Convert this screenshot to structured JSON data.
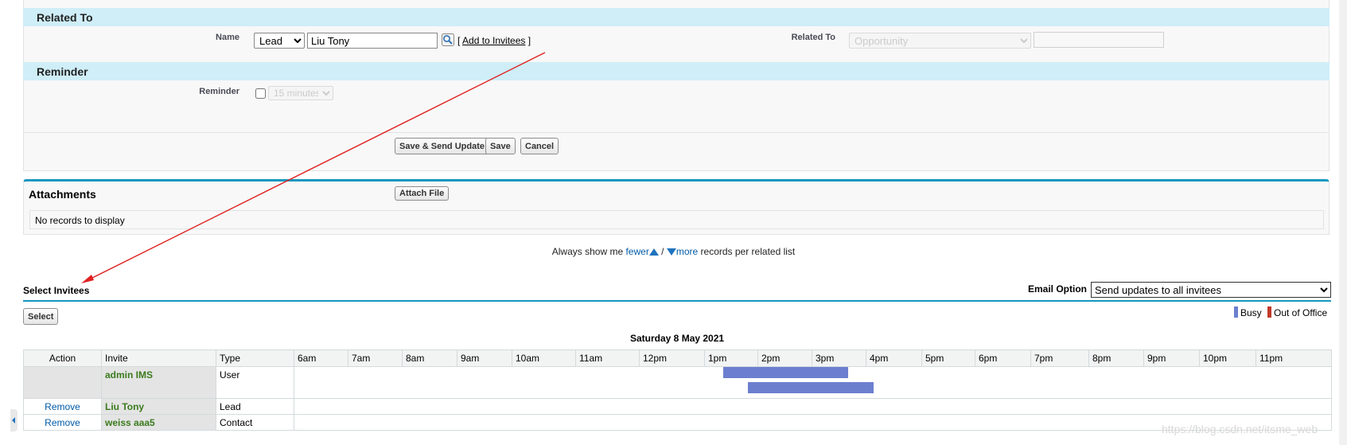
{
  "related_section": {
    "title": "Related To",
    "name_label": "Name",
    "name_type_selected": "Lead",
    "name_value": "Liu Tony",
    "add_to_invitees_label": "Add to Invitees",
    "related_to_label": "Related To",
    "related_to_selected": "Opportunity",
    "related_to_value": ""
  },
  "reminder_section": {
    "title": "Reminder",
    "reminder_label": "Reminder",
    "reminder_selected": "15 minutes"
  },
  "actions": {
    "save_send_label": "Save  & Send Update",
    "save_label": "Save",
    "cancel_label": "Cancel"
  },
  "attachments": {
    "title": "Attachments",
    "attach_button_label": "Attach File",
    "empty_text": "No records to display"
  },
  "records_per_list": {
    "prefix": "Always show me",
    "fewer_label": "fewer",
    "separator": "/",
    "more_label": "more",
    "suffix": "records per related list"
  },
  "invitees": {
    "title": "Select Invitees",
    "select_button_label": "Select",
    "email_option_label": "Email Option",
    "email_option_selected": "Send updates to all invitees",
    "legend": [
      {
        "label": "Busy",
        "color": "#6c7fcf"
      },
      {
        "label": "Out of Office",
        "color": "#c0392b"
      }
    ],
    "date_title": "Saturday 8 May 2021",
    "columns": [
      "Action",
      "Invite",
      "Type"
    ],
    "hours": [
      "6am",
      "7am",
      "8am",
      "9am",
      "10am",
      "11am",
      "12pm",
      "1pm",
      "2pm",
      "3pm",
      "4pm",
      "5pm",
      "6pm",
      "7pm",
      "8pm",
      "9pm",
      "10pm",
      "11pm"
    ],
    "rows": [
      {
        "action": "",
        "invite": "admin IMS",
        "type": "User"
      },
      {
        "action": "Remove",
        "invite": "Liu Tony",
        "type": "Lead"
      },
      {
        "action": "Remove",
        "invite": "weiss aaa5",
        "type": "Contact"
      }
    ]
  },
  "watermark": "https://blog.csdn.net/itsme_web",
  "colors": {
    "section_header_bg": "#cfeef8",
    "accent_line": "#1797c0",
    "link": "#015ba7",
    "invite_name": "#3a7a1d",
    "busy": "#6c7fcf",
    "arrow": "#e02020"
  }
}
